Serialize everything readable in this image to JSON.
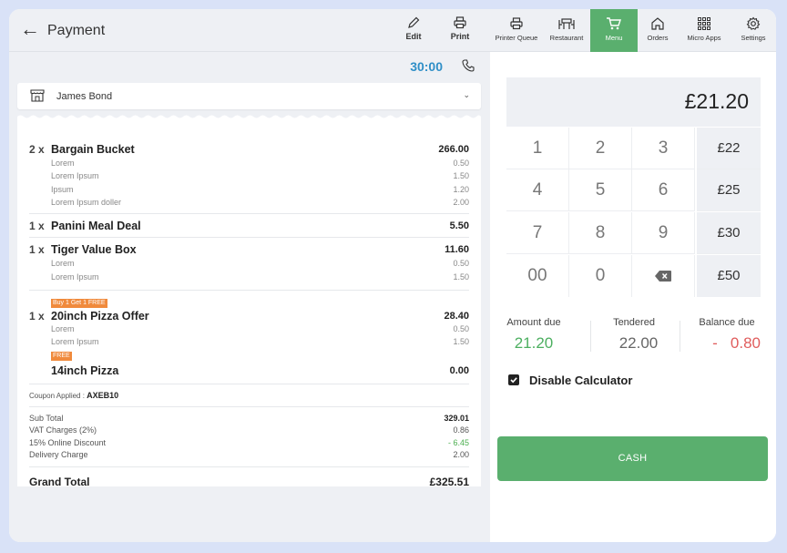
{
  "header": {
    "title": "Payment",
    "edit_label": "Edit",
    "print_label": "Print"
  },
  "timer": "30:00",
  "customer": {
    "name": "James Bond"
  },
  "order": {
    "items": [
      {
        "qty": "2 x",
        "name": "Bargain Bucket",
        "price": "266.00",
        "mods": [
          {
            "name": "Lorem",
            "price": "0.50"
          },
          {
            "name": "Lorem Ipsum",
            "price": "1.50"
          },
          {
            "name": "Ipsum",
            "price": "1.20"
          },
          {
            "name": "Lorem Ipsum doller",
            "price": "2.00"
          }
        ]
      },
      {
        "qty": "1 x",
        "name": "Panini Meal Deal",
        "price": "5.50"
      },
      {
        "qty": "1 x",
        "name": "Tiger Value Box",
        "price": "11.60",
        "mods": [
          {
            "name": "Lorem",
            "price": "0.50"
          },
          {
            "name": "Lorem Ipsum",
            "price": "1.50"
          }
        ]
      },
      {
        "badge": "Buy 1 Get 1 FREE",
        "qty": "1 x",
        "name": "20inch Pizza Offer",
        "price": "28.40",
        "mods": [
          {
            "name": "Lorem",
            "price": "0.50"
          },
          {
            "name": "Lorem Ipsum",
            "price": "1.50"
          }
        ],
        "free_badge": "FREE",
        "free_name": "14inch Pizza",
        "free_price": "0.00"
      }
    ],
    "coupon_label": "Coupon Applied :",
    "coupon_code": "AXEB10",
    "totals": [
      {
        "label": "Sub Total",
        "value": "329.01"
      },
      {
        "label": "VAT Charges (2%)",
        "value": "0.86"
      },
      {
        "label": "15% Online Discount",
        "value": "- 6.45"
      },
      {
        "label": "Delivery Charge",
        "value": "2.00"
      }
    ],
    "grand_total_label": "Grand Total",
    "grand_total_value": "£325.51"
  },
  "nav": [
    {
      "label": "Printer Queue",
      "icon": "printer-icon"
    },
    {
      "label": "Restaurant",
      "icon": "restaurant-icon"
    },
    {
      "label": "Menu",
      "icon": "cart-icon",
      "active": true
    },
    {
      "label": "Orders",
      "icon": "home-icon"
    },
    {
      "label": "Micro Apps",
      "icon": "grid-icon"
    },
    {
      "label": "Settings",
      "icon": "gear-icon"
    }
  ],
  "display_amount": "£21.20",
  "keypad": {
    "digits": [
      "1",
      "2",
      "3",
      "4",
      "5",
      "6",
      "7",
      "8",
      "9",
      "00",
      "0"
    ],
    "quick": [
      "£22",
      "£25",
      "£30",
      "£50"
    ]
  },
  "summary": {
    "amount_due_label": "Amount due",
    "amount_due": "21.20",
    "tendered_label": "Tendered",
    "tendered": "22.00",
    "balance_due_label": "Balance due",
    "balance_sign": "-",
    "balance_due": "0.80"
  },
  "colors": {
    "accent_green": "#5aaf6e",
    "timer_blue": "#2f8fc7",
    "discount_green": "#4caf50",
    "balance_red": "#e05d5d",
    "badge_orange": "#f08a3c"
  },
  "disable_calculator_label": "Disable Calculator",
  "cash_label": "CASH"
}
